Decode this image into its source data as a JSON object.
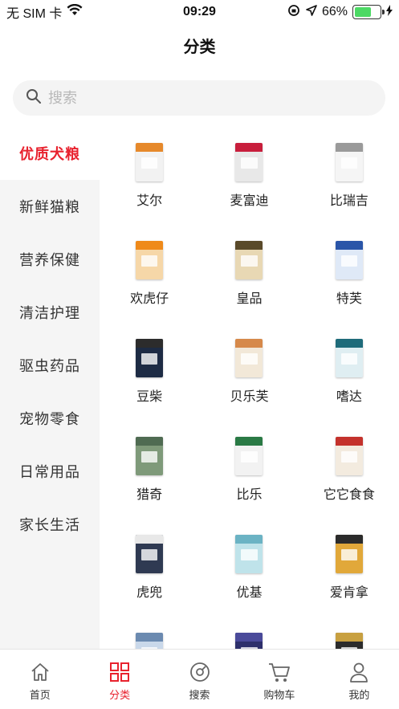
{
  "status_bar": {
    "carrier": "无 SIM 卡",
    "time": "09:29",
    "battery": "66%",
    "battery_level": 0.66
  },
  "nav": {
    "title": "分类"
  },
  "search": {
    "placeholder": "搜索"
  },
  "sidebar": {
    "items": [
      {
        "label": "优质犬粮",
        "active": true
      },
      {
        "label": "新鲜猫粮"
      },
      {
        "label": "营养保健"
      },
      {
        "label": "清洁护理"
      },
      {
        "label": "驱虫药品"
      },
      {
        "label": "宠物零食"
      },
      {
        "label": "日常用品"
      },
      {
        "label": "家长生活"
      }
    ]
  },
  "products": [
    {
      "name": "艾尔",
      "color": "#f2f2f2",
      "band": "#e6892b"
    },
    {
      "name": "麦富迪",
      "color": "#e8e8e8",
      "band": "#c81e3c"
    },
    {
      "name": "比瑞吉",
      "color": "#f5f5f5",
      "band": "#9a9a9a"
    },
    {
      "name": "欢虎仔",
      "color": "#f6d7a8",
      "band": "#ef8a1a"
    },
    {
      "name": "皇品",
      "color": "#e8d8b4",
      "band": "#5a4a2a"
    },
    {
      "name": "特芙",
      "color": "#dfe9f7",
      "band": "#2a55a8"
    },
    {
      "name": "豆柴",
      "color": "#1d2b44",
      "band": "#2c2c2c"
    },
    {
      "name": "贝乐芙",
      "color": "#f2e8d8",
      "band": "#d6894a"
    },
    {
      "name": "嗜达",
      "color": "#dfeef2",
      "band": "#1e6b7a"
    },
    {
      "name": "猎奇",
      "color": "#7f9a7a",
      "band": "#4f6b52"
    },
    {
      "name": "比乐",
      "color": "#f2f2f2",
      "band": "#2a7a45"
    },
    {
      "name": "它它食食",
      "color": "#f3ebdf",
      "band": "#c4322c"
    },
    {
      "name": "虎兜",
      "color": "#2f3a52",
      "band": "#e8e8e8"
    },
    {
      "name": "优基",
      "color": "#bfe3ea",
      "band": "#6bb3c4"
    },
    {
      "name": "爱肯拿",
      "color": "#e1a83a",
      "band": "#2b2b2b"
    },
    {
      "name": "",
      "color": "#c9d8ea",
      "band": "#6b8ab0"
    },
    {
      "name": "",
      "color": "#2d2f6b",
      "band": "#4a4a9a"
    },
    {
      "name": "",
      "color": "#2b2b2b",
      "band": "#c8a040"
    }
  ],
  "tabbar": {
    "items": [
      {
        "label": "首页",
        "icon": "home-icon"
      },
      {
        "label": "分类",
        "icon": "grid-icon",
        "active": true
      },
      {
        "label": "搜索",
        "icon": "compass-icon"
      },
      {
        "label": "购物车",
        "icon": "cart-icon"
      },
      {
        "label": "我的",
        "icon": "user-icon"
      }
    ]
  }
}
